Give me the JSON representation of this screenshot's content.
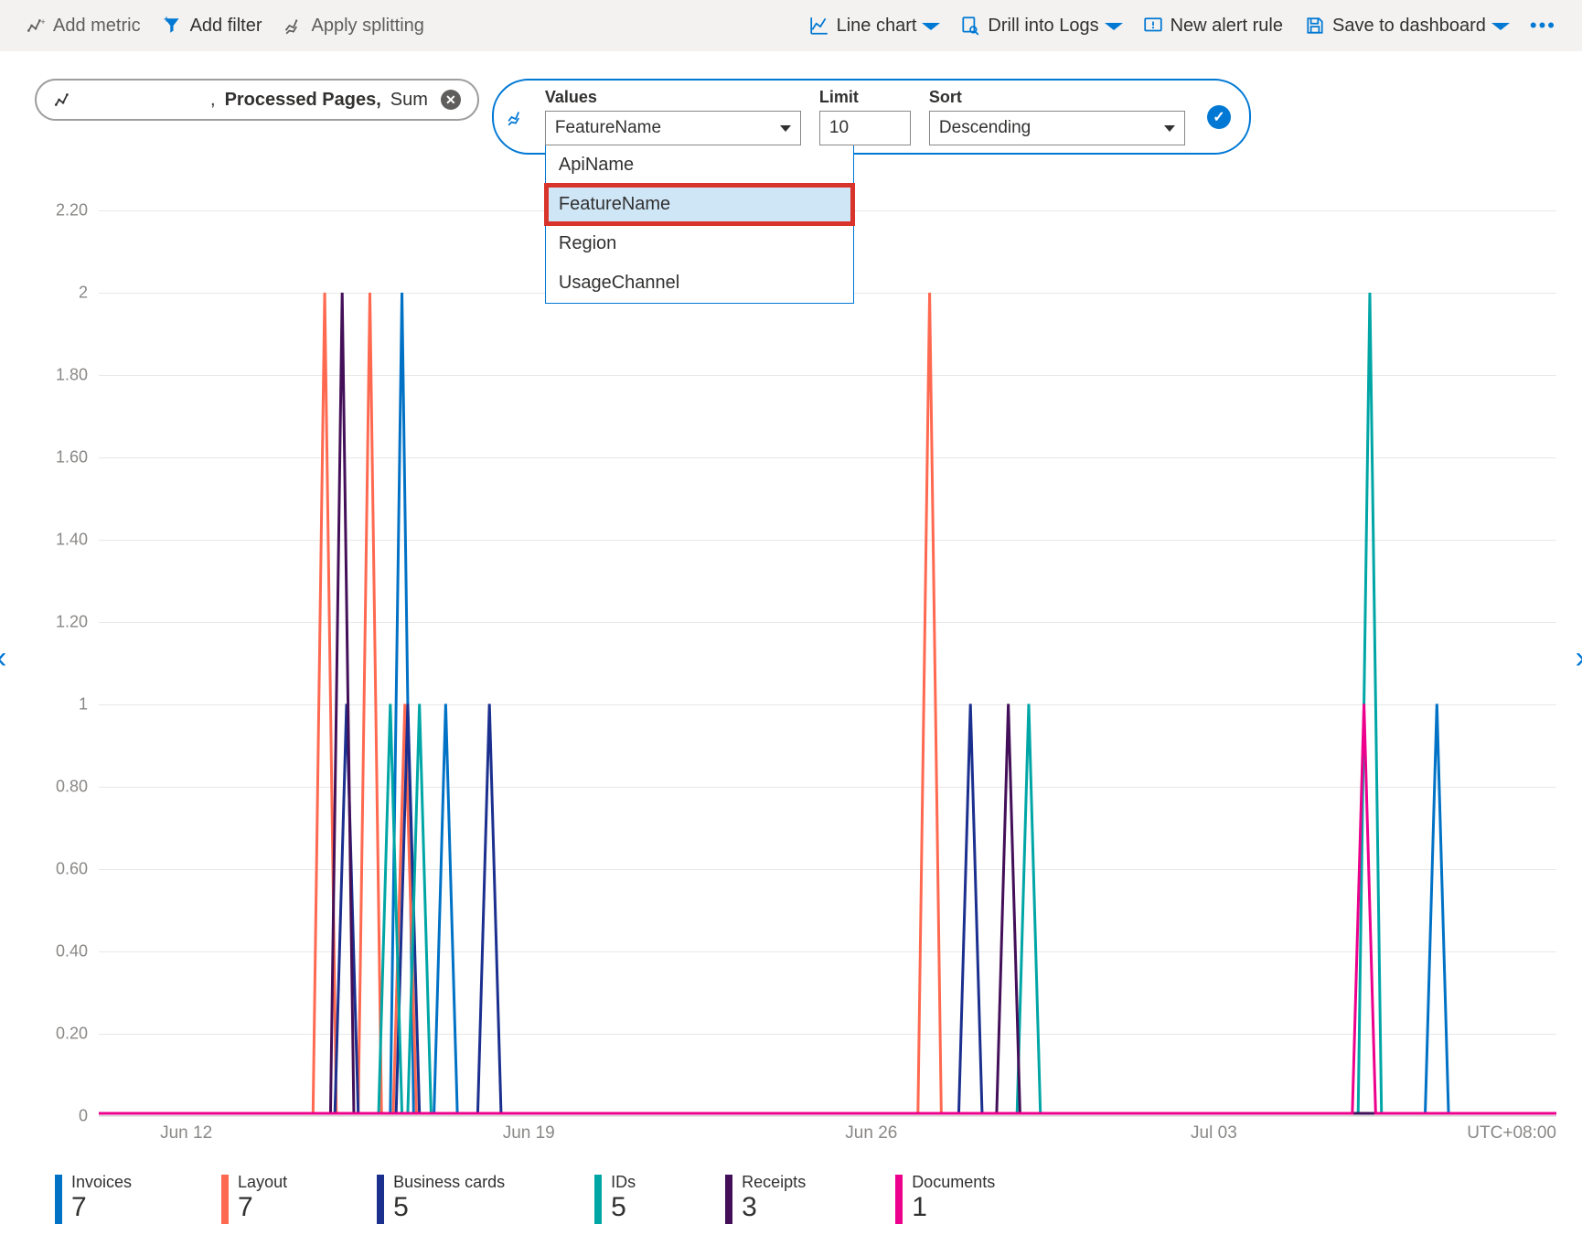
{
  "toolbar": {
    "add_metric": "Add metric",
    "add_filter": "Add filter",
    "apply_splitting": "Apply splitting",
    "line_chart": "Line chart",
    "drill_logs": "Drill into Logs",
    "new_alert": "New alert rule",
    "save_dashboard": "Save to dashboard"
  },
  "metric_pill": {
    "prefix": ",",
    "name": "Processed Pages,",
    "agg": "Sum"
  },
  "split": {
    "values_label": "Values",
    "limit_label": "Limit",
    "sort_label": "Sort",
    "values_value": "FeatureName",
    "limit_value": "10",
    "sort_value": "Descending",
    "options": [
      "ApiName",
      "FeatureName",
      "Region",
      "UsageChannel"
    ],
    "selected_index": 1
  },
  "chart_data": {
    "type": "line",
    "ylabel": "",
    "ylim": [
      0,
      2.2
    ],
    "y_ticks": [
      "2.20",
      "2",
      "1.80",
      "1.60",
      "1.40",
      "1.20",
      "1",
      "0.80",
      "0.60",
      "0.40",
      "0.20",
      "0"
    ],
    "x_ticks": [
      "Jun 12",
      "Jun 19",
      "Jun 26",
      "Jul 03"
    ],
    "x_tz": "UTC+08:00",
    "series": [
      {
        "name": "Invoices",
        "total": "7",
        "color": "#0072c6",
        "points": [
          [
            0.212,
            2
          ],
          [
            0.242,
            1
          ]
        ],
        "spikes2": [
          [
            0.922,
            1
          ]
        ]
      },
      {
        "name": "Layout",
        "total": "7",
        "color": "#ff6950",
        "points": [
          [
            0.157,
            2
          ],
          [
            0.188,
            2
          ],
          [
            0.212,
            1
          ]
        ],
        "spikes2": [
          [
            0.572,
            2
          ]
        ]
      },
      {
        "name": "Business cards",
        "total": "5",
        "color": "#1b2f8f",
        "points": [
          [
            0.17,
            1
          ],
          [
            0.212,
            1
          ],
          [
            0.268,
            1
          ]
        ],
        "spikes2": [
          [
            0.598,
            1
          ]
        ]
      },
      {
        "name": "IDs",
        "total": "5",
        "color": "#00a6a6",
        "points": [
          [
            0.198,
            1
          ],
          [
            0.218,
            1
          ]
        ],
        "spikes2": [
          [
            0.636,
            1
          ],
          [
            0.87,
            2
          ]
        ]
      },
      {
        "name": "Receipts",
        "total": "3",
        "color": "#430f58",
        "points": [
          [
            0.163,
            2
          ]
        ],
        "spikes2": [
          [
            0.62,
            1
          ]
        ]
      },
      {
        "name": "Documents",
        "total": "1",
        "color": "#ec008c",
        "points": [],
        "spikes2": [
          [
            0.862,
            1
          ]
        ]
      }
    ]
  },
  "colors": {
    "invoices": "#0072c6",
    "layout": "#ff6950",
    "business": "#1b2f8f",
    "ids": "#00a6a6",
    "receipts": "#430f58",
    "documents": "#ec008c"
  }
}
